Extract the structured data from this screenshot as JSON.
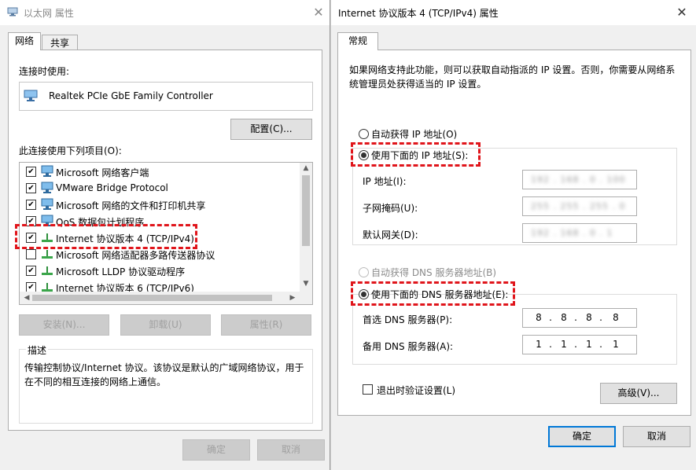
{
  "left_window": {
    "title": "以太网 属性",
    "close_glyph": "✕",
    "tabs": [
      {
        "label": "网络",
        "active": true
      },
      {
        "label": "共享",
        "active": false
      }
    ],
    "connect_using_label": "连接时使用:",
    "adapter_name": "Realtek PCIe GbE Family Controller",
    "configure_button": "配置(C)...",
    "items_label": "此连接使用下列项目(O):",
    "items": [
      {
        "label": "Microsoft 网络客户端",
        "checked": true,
        "icon": "network-client-icon"
      },
      {
        "label": "VMware Bridge Protocol",
        "checked": true,
        "icon": "network-client-icon"
      },
      {
        "label": "Microsoft 网络的文件和打印机共享",
        "checked": true,
        "icon": "network-client-icon"
      },
      {
        "label": "QoS 数据包计划程序",
        "checked": true,
        "icon": "network-client-icon"
      },
      {
        "label": "Internet 协议版本 4 (TCP/IPv4)",
        "checked": true,
        "icon": "protocol-icon"
      },
      {
        "label": "Microsoft 网络适配器多路传送器协议",
        "checked": false,
        "icon": "protocol-icon"
      },
      {
        "label": "Microsoft LLDP 协议驱动程序",
        "checked": true,
        "icon": "protocol-icon"
      },
      {
        "label": "Internet 协议版本 6 (TCP/IPv6)",
        "checked": true,
        "icon": "protocol-icon"
      }
    ],
    "install_button": "安装(N)...",
    "uninstall_button": "卸载(U)",
    "properties_button": "属性(R)",
    "description_title": "描述",
    "description_text": "传输控制协议/Internet 协议。该协议是默认的广域网络协议，用于在不同的相互连接的网络上通信。",
    "ok_button": "确定",
    "cancel_button": "取消"
  },
  "right_window": {
    "title": "Internet 协议版本 4 (TCP/IPv4) 属性",
    "close_glyph": "✕",
    "tab": "常规",
    "intro_text": "如果网络支持此功能，则可以获取自动指派的 IP 设置。否则，你需要从网络系统管理员处获得适当的 IP 设置。",
    "auto_ip_label": "自动获得 IP 地址(O)",
    "manual_ip_label": "使用下面的 IP 地址(S):",
    "ip_address_label": "IP 地址(I):",
    "subnet_mask_label": "子网掩码(U):",
    "gateway_label": "默认网关(D):",
    "ip_address_value": "192 . 168 . 0 . 100",
    "subnet_mask_value": "255 . 255 . 255 . 0",
    "gateway_value": "192 . 168 . 0 . 1",
    "auto_dns_label": "自动获得 DNS 服务器地址(B)",
    "manual_dns_label": "使用下面的 DNS 服务器地址(E):",
    "preferred_dns_label": "首选 DNS 服务器(P):",
    "alternate_dns_label": "备用 DNS 服务器(A):",
    "preferred_dns": [
      "8",
      "8",
      "8",
      "8"
    ],
    "alternate_dns": [
      "1",
      "1",
      "1",
      "1"
    ],
    "validate_label": "退出时验证设置(L)",
    "advanced_button": "高级(V)...",
    "ok_button": "确定",
    "cancel_button": "取消"
  },
  "colors": {
    "highlight_dash": "#e0151b",
    "window_bg": "#f0f0f0",
    "primary_border": "#0078d7"
  }
}
